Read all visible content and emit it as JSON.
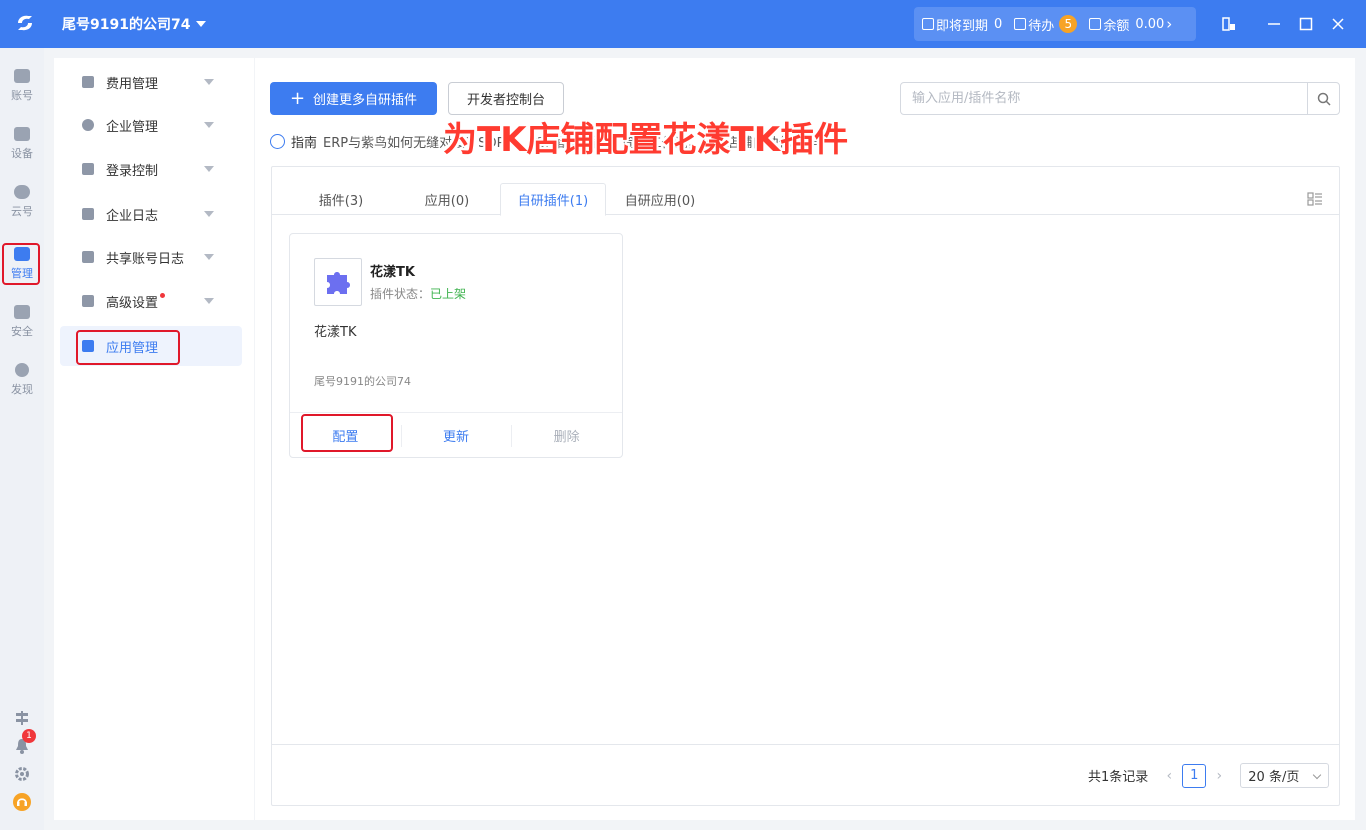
{
  "titlebar": {
    "company": "尾号9191的公司74",
    "expiring_label": "即将到期",
    "expiring_count": "0",
    "todo_label": "待办",
    "todo_count": "5",
    "balance_label": "余额",
    "balance_value": "0.00"
  },
  "rail": {
    "items": [
      {
        "label": "账号",
        "icon": "account-icon"
      },
      {
        "label": "设备",
        "icon": "device-icon"
      },
      {
        "label": "云号",
        "icon": "cloud-icon"
      },
      {
        "label": "管理",
        "icon": "manage-icon"
      },
      {
        "label": "安全",
        "icon": "security-icon"
      },
      {
        "label": "发现",
        "icon": "discover-icon"
      }
    ],
    "notification_count": "1"
  },
  "sidenav": {
    "items": [
      {
        "label": "费用管理"
      },
      {
        "label": "企业管理"
      },
      {
        "label": "登录控制"
      },
      {
        "label": "企业日志"
      },
      {
        "label": "共享账号日志"
      },
      {
        "label": "高级设置"
      },
      {
        "label": "应用管理"
      }
    ]
  },
  "toolbar": {
    "create_label": "创建更多自研插件",
    "devconsole_label": "开发者控制台",
    "search_placeholder": "输入应用/插件名称"
  },
  "guide": {
    "label": "指南",
    "text": "ERP与紫鸟如何无缝对接？SOP...... 如何配置插件？简化工作流，实现店铺自动化操作。"
  },
  "overlay": {
    "title": "为TK店铺配置花漾TK插件"
  },
  "tabs": [
    {
      "label": "插件(3)"
    },
    {
      "label": "应用(0)"
    },
    {
      "label": "自研插件(1)"
    },
    {
      "label": "自研应用(0)"
    }
  ],
  "card": {
    "name": "花漾TK",
    "status_label": "插件状态：",
    "status_value": "已上架",
    "description": "花漾TK",
    "owner": "尾号9191的公司74",
    "actions": {
      "configure": "配置",
      "update": "更新",
      "delete": "删除"
    }
  },
  "pagination": {
    "total": "共1条记录",
    "current_page": "1",
    "page_size": "20 条/页"
  },
  "colors": {
    "primary": "#3d7cf0",
    "highlight": "#e0182a",
    "success": "#3fb34f",
    "badge": "#f7a326"
  }
}
